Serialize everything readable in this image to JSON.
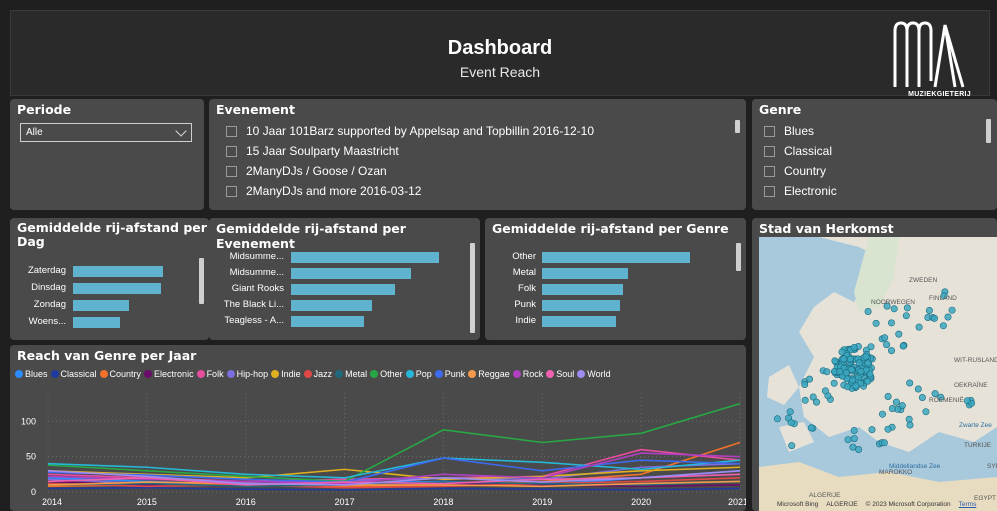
{
  "header": {
    "title": "Dashboard",
    "subtitle": "Event Reach",
    "logo_text": "MUZIEKGIETERIJ"
  },
  "periode": {
    "title": "Periode",
    "selected": "Alle"
  },
  "evenement": {
    "title": "Evenement",
    "items": [
      "10 Jaar 101Barz supported by Appelsap and Topbillin 2016-12-10",
      "15 Jaar Soulparty Maastricht",
      "2ManyDJs / Goose / Ozan",
      "2ManyDJs and more 2016-03-12"
    ]
  },
  "genre": {
    "title": "Genre",
    "items": [
      "Blues",
      "Classical",
      "Country",
      "Electronic"
    ]
  },
  "dag": {
    "title_line1": "Gemiddelde rij-afstand per",
    "title_line2": "Dag",
    "categories": [
      "Zaterdag",
      "Dinsdag",
      "Zondag",
      "Woens..."
    ],
    "values": [
      1.0,
      0.98,
      0.62,
      0.52
    ]
  },
  "evenement_chart": {
    "title": "Gemiddelde rij-afstand per Evenement",
    "categories": [
      "Midsumme...",
      "Midsumme...",
      "Giant Rooks",
      "The Black Li...",
      "Teagless - A..."
    ],
    "values": [
      1.0,
      0.81,
      0.7,
      0.55,
      0.49
    ]
  },
  "genre_chart": {
    "title": "Gemiddelde rij-afstand per Genre",
    "categories": [
      "Other",
      "Metal",
      "Folk",
      "Punk",
      "Indie"
    ],
    "values": [
      1.0,
      0.58,
      0.55,
      0.53,
      0.5
    ]
  },
  "herkomst": {
    "title": "Stad van Herkomst",
    "labels": [
      "ZWEDEN",
      "NOORWEGEN",
      "FINLAND",
      "WIT-RUSLAND",
      "OEKRAÏNE",
      "ROEMENIË",
      "Zwarte Zee",
      "TURKIJE",
      "Middellandse Zee",
      "MAROKKO",
      "ALGERIJE",
      "SYR",
      "EGYPT"
    ],
    "footer": [
      "Microsoft Bing",
      "ALGERIJE",
      "© 2023 Microsoft Corporation",
      "Terms"
    ]
  },
  "chart_data": {
    "type": "line",
    "title": "Reach van Genre per Jaar",
    "x": [
      2014,
      2015,
      2016,
      2017,
      2018,
      2019,
      2020,
      2021
    ],
    "ylim": [
      0,
      140
    ],
    "yticks": [
      0,
      50,
      100
    ],
    "grid": true,
    "legend_position": "top",
    "series": [
      {
        "name": "Blues",
        "color": "#2a8cff",
        "values": [
          20,
          15,
          10,
          12,
          15,
          10,
          20,
          30
        ]
      },
      {
        "name": "Classical",
        "color": "#1f3a9f",
        "values": [
          5,
          6,
          4,
          3,
          5,
          4,
          3,
          5
        ]
      },
      {
        "name": "Country",
        "color": "#f0722b",
        "values": [
          8,
          10,
          12,
          8,
          10,
          15,
          25,
          70
        ]
      },
      {
        "name": "Electronic",
        "color": "#6a0d6a",
        "values": [
          15,
          10,
          8,
          10,
          12,
          10,
          8,
          10
        ]
      },
      {
        "name": "Folk",
        "color": "#e84c9f",
        "values": [
          25,
          20,
          15,
          18,
          20,
          22,
          60,
          45
        ]
      },
      {
        "name": "Hip-hop",
        "color": "#7a6dde",
        "values": [
          18,
          12,
          14,
          16,
          20,
          18,
          35,
          40
        ]
      },
      {
        "name": "Indie",
        "color": "#e0b020",
        "values": [
          30,
          25,
          20,
          32,
          18,
          22,
          30,
          35
        ]
      },
      {
        "name": "Jazz",
        "color": "#e04848",
        "values": [
          12,
          8,
          10,
          6,
          8,
          12,
          15,
          20
        ]
      },
      {
        "name": "Metal",
        "color": "#1f6a7a",
        "values": [
          10,
          12,
          8,
          10,
          14,
          12,
          10,
          15
        ]
      },
      {
        "name": "Other",
        "color": "#27a845",
        "values": [
          38,
          30,
          22,
          15,
          88,
          70,
          83,
          125
        ]
      },
      {
        "name": "Pop",
        "color": "#25b8d8",
        "values": [
          40,
          35,
          25,
          20,
          48,
          42,
          32,
          45
        ]
      },
      {
        "name": "Punk",
        "color": "#3d6bf0",
        "values": [
          28,
          24,
          18,
          14,
          48,
          30,
          45,
          40
        ]
      },
      {
        "name": "Reggae",
        "color": "#f59a4a",
        "values": [
          10,
          14,
          12,
          10,
          10,
          8,
          12,
          15
        ]
      },
      {
        "name": "Rock",
        "color": "#b040c0",
        "values": [
          22,
          18,
          15,
          12,
          25,
          20,
          55,
          50
        ]
      },
      {
        "name": "Soul",
        "color": "#f060b0",
        "values": [
          15,
          20,
          10,
          14,
          12,
          18,
          20,
          25
        ]
      },
      {
        "name": "World",
        "color": "#a08cf0",
        "values": [
          30,
          22,
          12,
          10,
          20,
          14,
          20,
          30
        ]
      }
    ]
  }
}
